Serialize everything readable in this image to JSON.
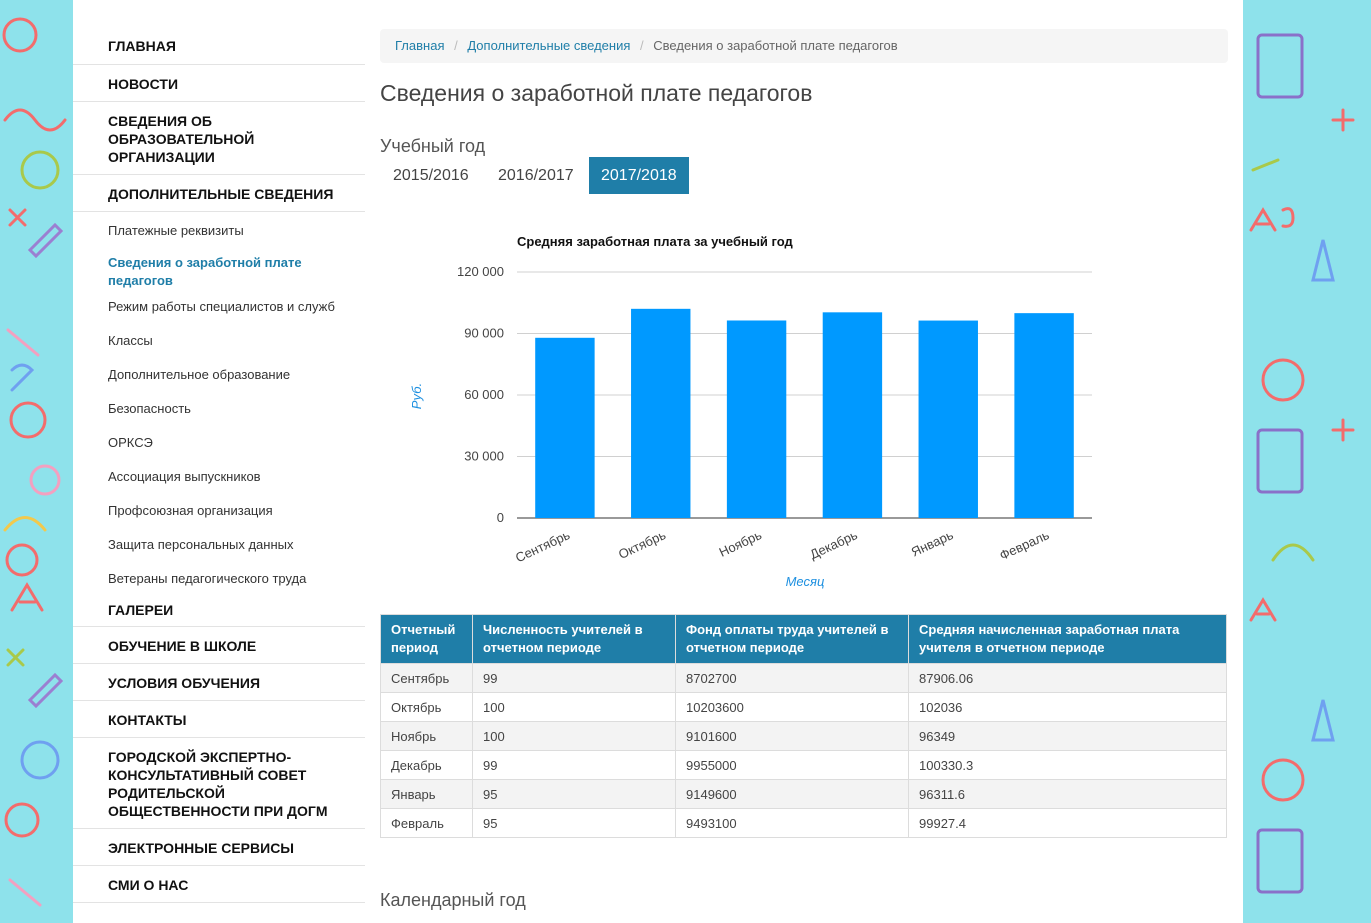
{
  "sidebar": {
    "main_items_top": [
      {
        "label": "ГЛАВНАЯ"
      },
      {
        "label": "НОВОСТИ"
      },
      {
        "label": "СВЕДЕНИЯ ОБ ОБРАЗОВАТЕЛЬНОЙ ОРГАНИЗАЦИИ"
      },
      {
        "label": "ДОПОЛНИТЕЛЬНЫЕ СВЕДЕНИЯ"
      }
    ],
    "sub_items": [
      {
        "label": "Платежные реквизиты"
      },
      {
        "label": "Сведения о заработной плате педагогов"
      },
      {
        "label": "Режим работы специалистов и служб"
      },
      {
        "label": "Классы"
      },
      {
        "label": "Дополнительное образование"
      },
      {
        "label": "Безопасность"
      },
      {
        "label": "ОРКСЭ"
      },
      {
        "label": "Ассоциация выпускников"
      },
      {
        "label": "Профсоюзная организация"
      },
      {
        "label": "Защита персональных данных"
      },
      {
        "label": "Ветераны педагогического труда"
      }
    ],
    "main_items_bottom": [
      {
        "label": "ГАЛЕРЕИ"
      },
      {
        "label": "ОБУЧЕНИЕ В ШКОЛЕ"
      },
      {
        "label": "УСЛОВИЯ ОБУЧЕНИЯ"
      },
      {
        "label": "КОНТАКТЫ"
      },
      {
        "label": "ГОРОДСКОЙ ЭКСПЕРТНО-КОНСУЛЬТАТИВНЫЙ СОВЕТ РОДИТЕЛЬСКОЙ ОБЩЕСТВЕННОСТИ ПРИ ДОГМ"
      },
      {
        "label": "ЭЛЕКТРОННЫЕ СЕРВИСЫ"
      },
      {
        "label": "СМИ О НАС"
      }
    ]
  },
  "breadcrumb": {
    "home": "Главная",
    "parent": "Дополнительные сведения",
    "current": "Сведения о заработной плате педагогов",
    "separator": "/"
  },
  "page": {
    "title": "Сведения о заработной плате педагогов",
    "year_label": "Учебный год",
    "calendar_year_label": "Календарный год"
  },
  "tabs": [
    {
      "label": "2015/2016",
      "active": false
    },
    {
      "label": "2016/2017",
      "active": false
    },
    {
      "label": "2017/2018",
      "active": true
    }
  ],
  "colors": {
    "accent": "#1f7ea8",
    "bar": "#0099ff",
    "axis_title": "#1e90e0"
  },
  "chart_data": {
    "type": "bar",
    "title": "Средняя заработная плата за учебный год",
    "xlabel": "Месяц",
    "ylabel": "Руб.",
    "categories": [
      "Сентябрь",
      "Октябрь",
      "Ноябрь",
      "Декабрь",
      "Январь",
      "Февраль"
    ],
    "values": [
      87906.06,
      102036,
      96349,
      100330.3,
      96311.6,
      99927.4
    ],
    "ylim": [
      0,
      120000
    ],
    "yticks": [
      0,
      30000,
      60000,
      90000,
      120000
    ],
    "ytick_labels": [
      "0",
      "30 000",
      "60 000",
      "90 000",
      "120 000"
    ],
    "grid": true
  },
  "table": {
    "headers": [
      "Отчетный период",
      "Численность учителей в отчетном периоде",
      "Фонд оплаты труда учителей в отчетном периоде",
      "Средняя начисленная заработная плата учителя в отчетном периоде"
    ],
    "rows": [
      [
        "Сентябрь",
        "99",
        "8702700",
        "87906.06"
      ],
      [
        "Октябрь",
        "100",
        "10203600",
        "102036"
      ],
      [
        "Ноябрь",
        "100",
        "9101600",
        "96349"
      ],
      [
        "Декабрь",
        "99",
        "9955000",
        "100330.3"
      ],
      [
        "Январь",
        "95",
        "9149600",
        "96311.6"
      ],
      [
        "Февраль",
        "95",
        "9493100",
        "99927.4"
      ]
    ]
  }
}
